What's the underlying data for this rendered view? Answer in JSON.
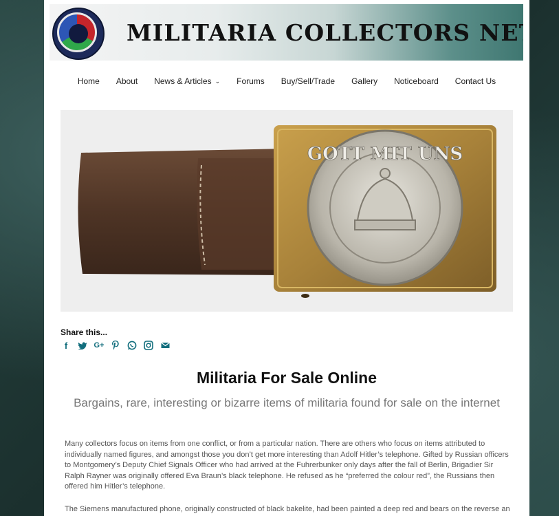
{
  "site": {
    "title": "MILITARIA COLLECTORS NETWORK",
    "logo_icon": "mcn-roundel-logo"
  },
  "nav": {
    "items": [
      {
        "label": "Home"
      },
      {
        "label": "About"
      },
      {
        "label": "News & Articles",
        "chevron": "chevron-down-icon"
      },
      {
        "label": "Forums"
      },
      {
        "label": "Buy/Sell/Trade"
      },
      {
        "label": "Gallery"
      },
      {
        "label": "Noticeboard"
      },
      {
        "label": "Contact Us"
      }
    ]
  },
  "hero": {
    "image_alt": "Brass belt buckle with leather tab",
    "buckle_text": "GOTT MIT UNS"
  },
  "share": {
    "title": "Share this...",
    "icons": [
      "facebook-icon",
      "twitter-icon",
      "google-plus-icon",
      "pinterest-icon",
      "whatsapp-icon",
      "instagram-icon",
      "email-icon"
    ],
    "accent": "#126e7d"
  },
  "article": {
    "title": "Militaria For Sale Online",
    "subtitle": "Bargains, rare, interesting or bizarre items of militaria found for sale on the internet",
    "paragraphs": [
      "Many collectors focus on items from one conflict, or from a particular nation. There are others who focus on items attributed to individually named figures, and amongst those you don’t get more interesting than Adolf Hitler’s telephone. Gifted by Russian officers to Montgomery’s Deputy Chief Signals Officer who had arrived at the Fuhrerbunker only days after the fall of Berlin, Brigadier Sir Ralph Rayner was originally offered Eva Braun’s black telephone. He refused as he “preferred the colour red”, the Russians then offered him Hitler’s telephone.",
      "The Siemens manufactured phone, originally constructed of black bakelite, had been painted a deep red and bears on the reverse an"
    ]
  }
}
